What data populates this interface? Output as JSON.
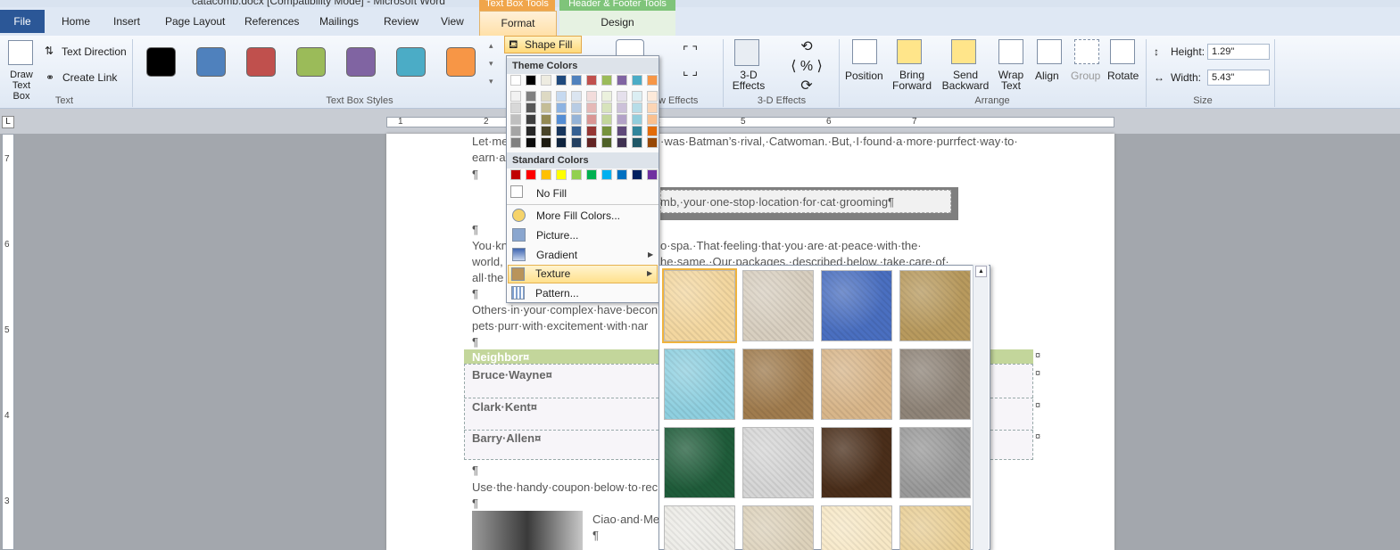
{
  "window": {
    "title": "catacomb.docx [Compatibility Mode] - Microsoft Word"
  },
  "tabs": [
    "File",
    "Home",
    "Insert",
    "Page Layout",
    "References",
    "Mailings",
    "Review",
    "View",
    "Format",
    "Design"
  ],
  "context_tabs": {
    "text_box_tools": "Text Box Tools",
    "header_footer_tools": "Header & Footer Tools"
  },
  "ribbon": {
    "text_group": {
      "draw_text_box": "Draw Text Box",
      "text_direction": "Text Direction",
      "create_link": "Create Link",
      "label": "Text"
    },
    "text_box_styles": {
      "label": "Text Box Styles",
      "swatches": [
        "#000000",
        "#4f81bd",
        "#c0504d",
        "#9bbb59",
        "#8064a2",
        "#4bacc6",
        "#f79646"
      ]
    },
    "shape_fill": "Shape Fill",
    "shadow_effects_label": "w Effects",
    "three_d": {
      "button": "3-D Effects",
      "label": "3-D Effects"
    },
    "arrange": {
      "position": "Position",
      "bring_forward": "Bring Forward",
      "send_backward": "Send Backward",
      "wrap_text": "Wrap Text",
      "align": "Align",
      "group": "Group",
      "rotate": "Rotate",
      "label": "Arrange"
    },
    "size": {
      "height_label": "Height:",
      "height_value": "1.29\"",
      "width_label": "Width:",
      "width_value": "5.43\"",
      "label": "Size"
    }
  },
  "ruler": {
    "h_numbers": [
      "1",
      "2",
      "3",
      "4",
      "5",
      "6",
      "7"
    ],
    "v_numbers": [
      "7",
      "6",
      "5",
      "4",
      "3"
    ]
  },
  "document": {
    "line1a": "Let·me",
    "line1b": "·was·Batman’s·rival,·Catwoman.·But,·I·found·a·more·purrfect·way·to·",
    "line2": "earn·a",
    "pilcrow": "¶",
    "banner": "mb,·your·one-stop·location·for·cat·grooming¶",
    "p2a": "You·kn",
    "p2b": "o·spa.·That·feeling·that·you·are·at·peace·with·the·",
    "p3a": "world,",
    "p3b": "he·same.·Our·packages,·described·below,·take·care·of·",
    "p4a": "all·the",
    "p5a": "Others·in·your·complex·have·becon",
    "p6a": "pets·purr·with·excitement·with·nar",
    "table_header": "Neighbor¤",
    "rows": [
      "Bruce·Wayne¤",
      "Clark·Kent¤",
      "Barry·Allen¤"
    ],
    "cell_mark": "¤",
    "coupon_line": "Use·the·handy·coupon·below·to·rec",
    "signoff": "Ciao·and·Me"
  },
  "fill_menu": {
    "theme_colors_label": "Theme Colors",
    "theme_top": [
      "#ffffff",
      "#000000",
      "#eeece1",
      "#1f497d",
      "#4f81bd",
      "#c0504d",
      "#9bbb59",
      "#8064a2",
      "#4bacc6",
      "#f79646"
    ],
    "theme_shades": [
      [
        "#f2f2f2",
        "#7f7f7f",
        "#ddd9c3",
        "#c6d9f0",
        "#dbe5f1",
        "#f2dcdb",
        "#ebf1dd",
        "#e5e0ec",
        "#dbeef3",
        "#fdeada"
      ],
      [
        "#d8d8d8",
        "#595959",
        "#c4bd97",
        "#8db3e2",
        "#b8cce4",
        "#e5b9b7",
        "#d7e3bc",
        "#ccc1d9",
        "#b7dde8",
        "#fbd5b5"
      ],
      [
        "#bfbfbf",
        "#3f3f3f",
        "#938953",
        "#548dd4",
        "#95b3d7",
        "#d99694",
        "#c3d69b",
        "#b2a2c7",
        "#92cddc",
        "#fac08f"
      ],
      [
        "#a5a5a5",
        "#262626",
        "#494429",
        "#17365d",
        "#366092",
        "#953734",
        "#76923c",
        "#5f497a",
        "#31859b",
        "#e36c09"
      ],
      [
        "#7f7f7f",
        "#0c0c0c",
        "#1d1b10",
        "#0f243e",
        "#244061",
        "#632423",
        "#4f6128",
        "#3f3151",
        "#205867",
        "#974806"
      ]
    ],
    "standard_colors_label": "Standard Colors",
    "standard": [
      "#c00000",
      "#ff0000",
      "#ffc000",
      "#ffff00",
      "#92d050",
      "#00b050",
      "#00b0f0",
      "#0070c0",
      "#002060",
      "#7030a0"
    ],
    "no_fill": "No Fill",
    "more_fill_colors": "More Fill Colors...",
    "picture": "Picture...",
    "gradient": "Gradient",
    "texture": "Texture",
    "pattern": "Pattern..."
  },
  "textures": [
    {
      "name": "papyrus",
      "color": "#f3d7a0"
    },
    {
      "name": "canvas",
      "color": "#d8cfc0"
    },
    {
      "name": "denim",
      "color": "#4a6fc0"
    },
    {
      "name": "woven-mat",
      "color": "#b89a5e"
    },
    {
      "name": "water-droplets",
      "color": "#8fd0e0"
    },
    {
      "name": "paper-bag",
      "color": "#a07c4e"
    },
    {
      "name": "fish-fossil",
      "color": "#d8b68a"
    },
    {
      "name": "sand",
      "color": "#8f8478"
    },
    {
      "name": "green-marble",
      "color": "#1f5c3a"
    },
    {
      "name": "white-marble",
      "color": "#d6d6d6"
    },
    {
      "name": "brown-marble",
      "color": "#4a2e1a"
    },
    {
      "name": "granite",
      "color": "#9a9a9a"
    },
    {
      "name": "newsprint",
      "color": "#ecebe6"
    },
    {
      "name": "recycled-paper",
      "color": "#ddd2bb"
    },
    {
      "name": "parchment",
      "color": "#f7e8c6"
    },
    {
      "name": "stationery",
      "color": "#e9cf96"
    }
  ]
}
